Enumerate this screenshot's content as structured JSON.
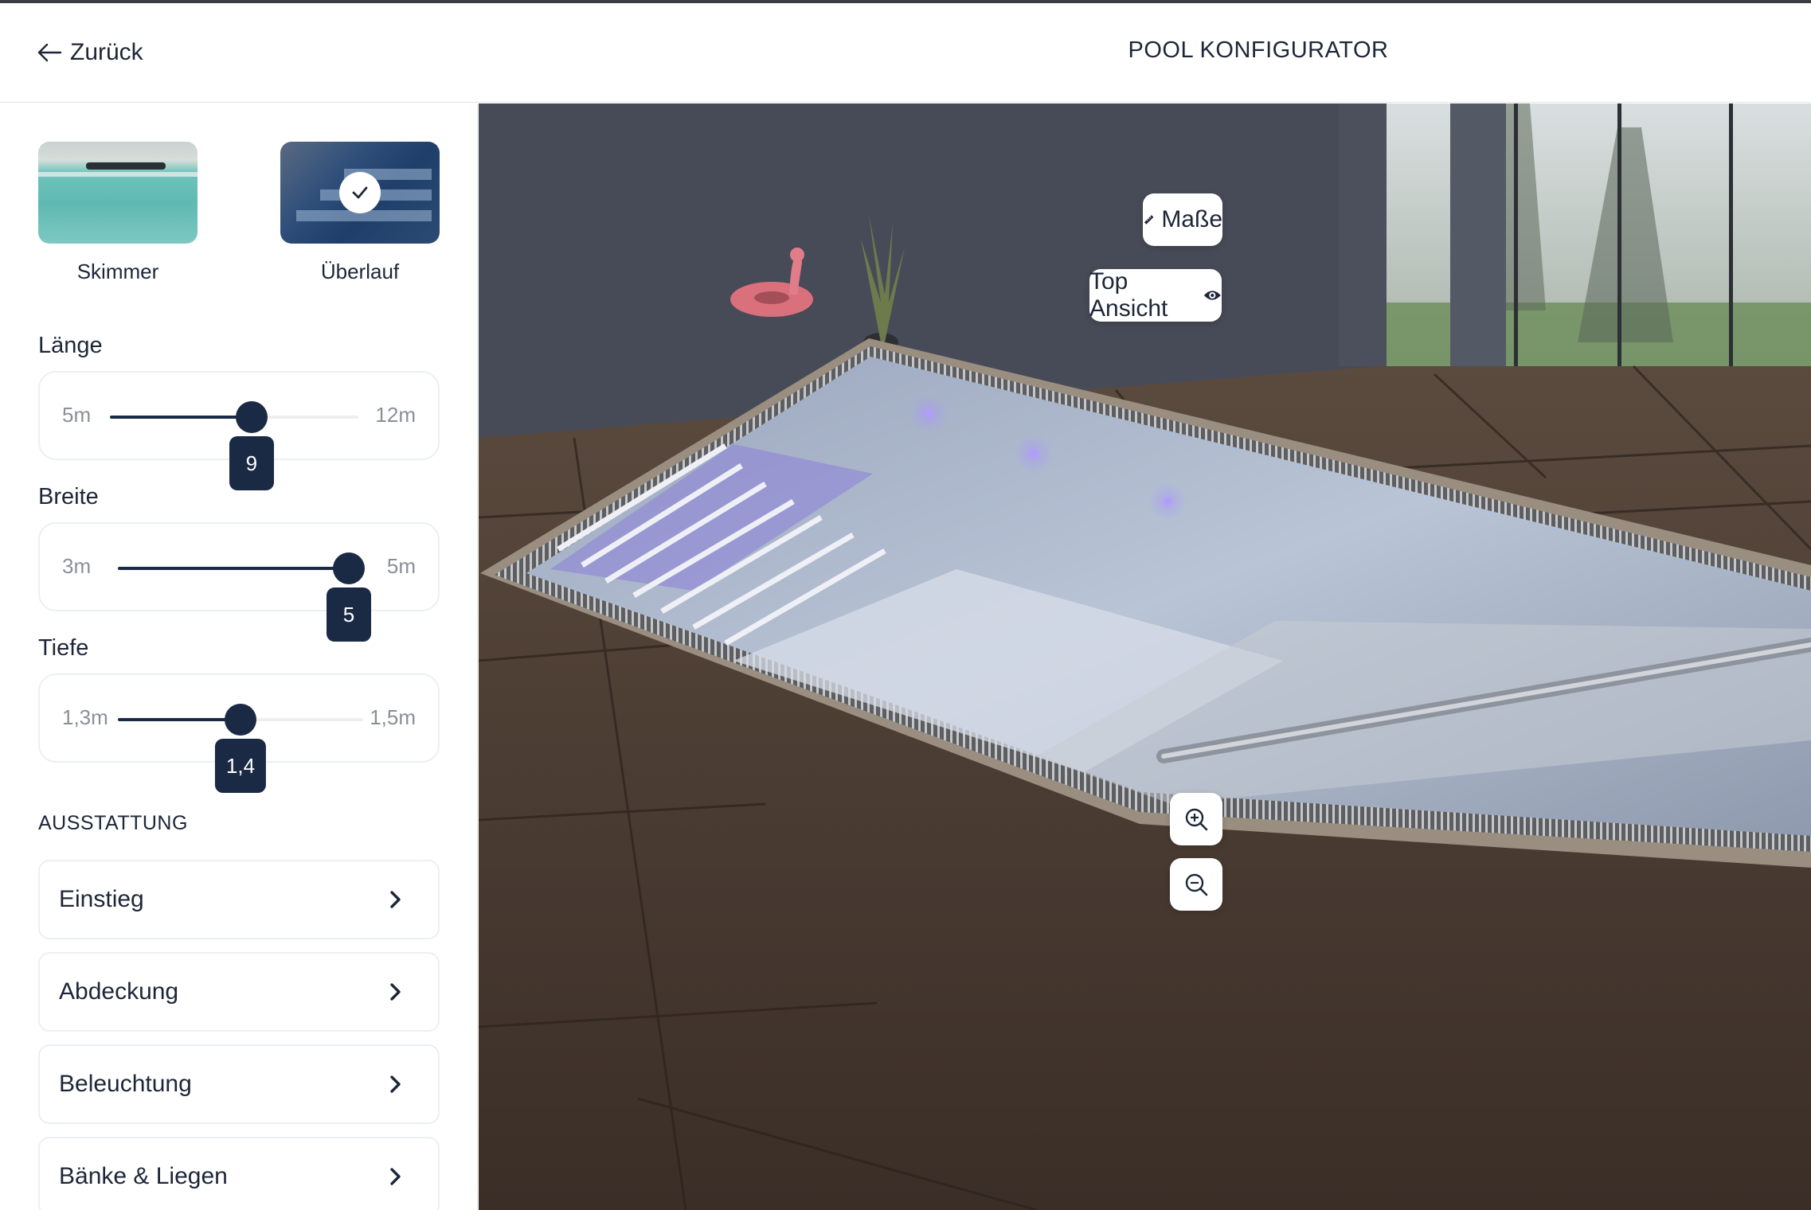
{
  "header": {
    "back_label": "Zurück",
    "title": "POOL KONFIGURATOR"
  },
  "sidebar": {
    "pool_types": [
      {
        "label": "Skimmer",
        "selected": false
      },
      {
        "label": "Überlauf",
        "selected": true
      }
    ],
    "sliders": [
      {
        "label": "Länge",
        "min": "5m",
        "max": "12m",
        "value": "9",
        "fraction": 0.57
      },
      {
        "label": "Breite",
        "min": "3m",
        "max": "5m",
        "value": "5",
        "fraction": 1.0
      },
      {
        "label": "Tiefe",
        "min": "1,3m",
        "max": "1,5m",
        "value": "1,4",
        "fraction": 0.5
      }
    ],
    "section_title": "AUSSTATTUNG",
    "items": [
      {
        "label": "Einstieg"
      },
      {
        "label": "Abdeckung"
      },
      {
        "label": "Beleuchtung"
      },
      {
        "label": "Bänke & Liegen"
      }
    ]
  },
  "viewport": {
    "masse_label": "Maße",
    "top_view_label": "Top Ansicht",
    "zoom_in_icon": "zoom-in-icon",
    "zoom_out_icon": "zoom-out-icon"
  },
  "colors": {
    "accent": "#1b2a44",
    "wall": "#474b57",
    "floor": "#4a3b30",
    "water": "#b7c3d6",
    "light_purple": "#9b8cf0"
  }
}
